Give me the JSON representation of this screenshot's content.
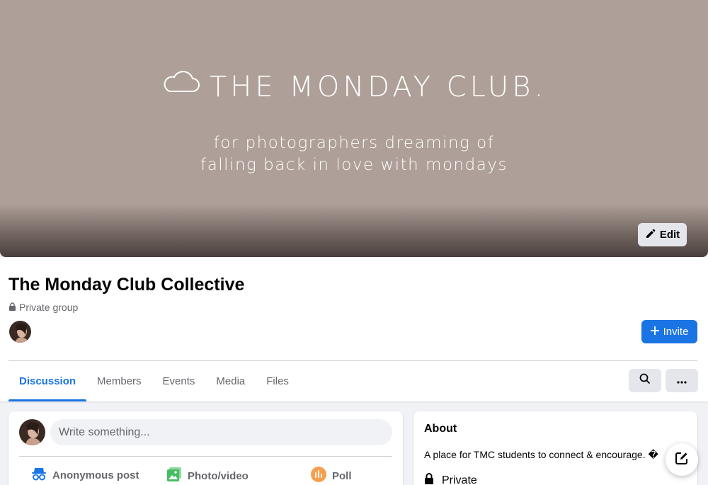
{
  "cover": {
    "title": "THE MONDAY CLUB.",
    "subtitle_line1": "for photographers dreaming of",
    "subtitle_line2": "falling back in love with mondays",
    "edit_label": "Edit"
  },
  "group": {
    "name": "The Monday Club Collective",
    "privacy": "Private group",
    "invite_label": "Invite"
  },
  "tabs": [
    {
      "label": "Discussion",
      "active": true
    },
    {
      "label": "Members",
      "active": false
    },
    {
      "label": "Events",
      "active": false
    },
    {
      "label": "Media",
      "active": false
    },
    {
      "label": "Files",
      "active": false
    }
  ],
  "composer": {
    "placeholder": "Write something...",
    "actions": {
      "anonymous": "Anonymous post",
      "photo": "Photo/video",
      "poll": "Poll"
    }
  },
  "about": {
    "title": "About",
    "description": "A place for TMC students to connect & encourage. �",
    "privacy": "Private"
  },
  "colors": {
    "accent": "#1b74e4",
    "cover_bg": "#ae9f98",
    "photo_icon": "#45bd62",
    "poll_icon": "#f7b928",
    "anon_icon": "#1b74e4"
  }
}
